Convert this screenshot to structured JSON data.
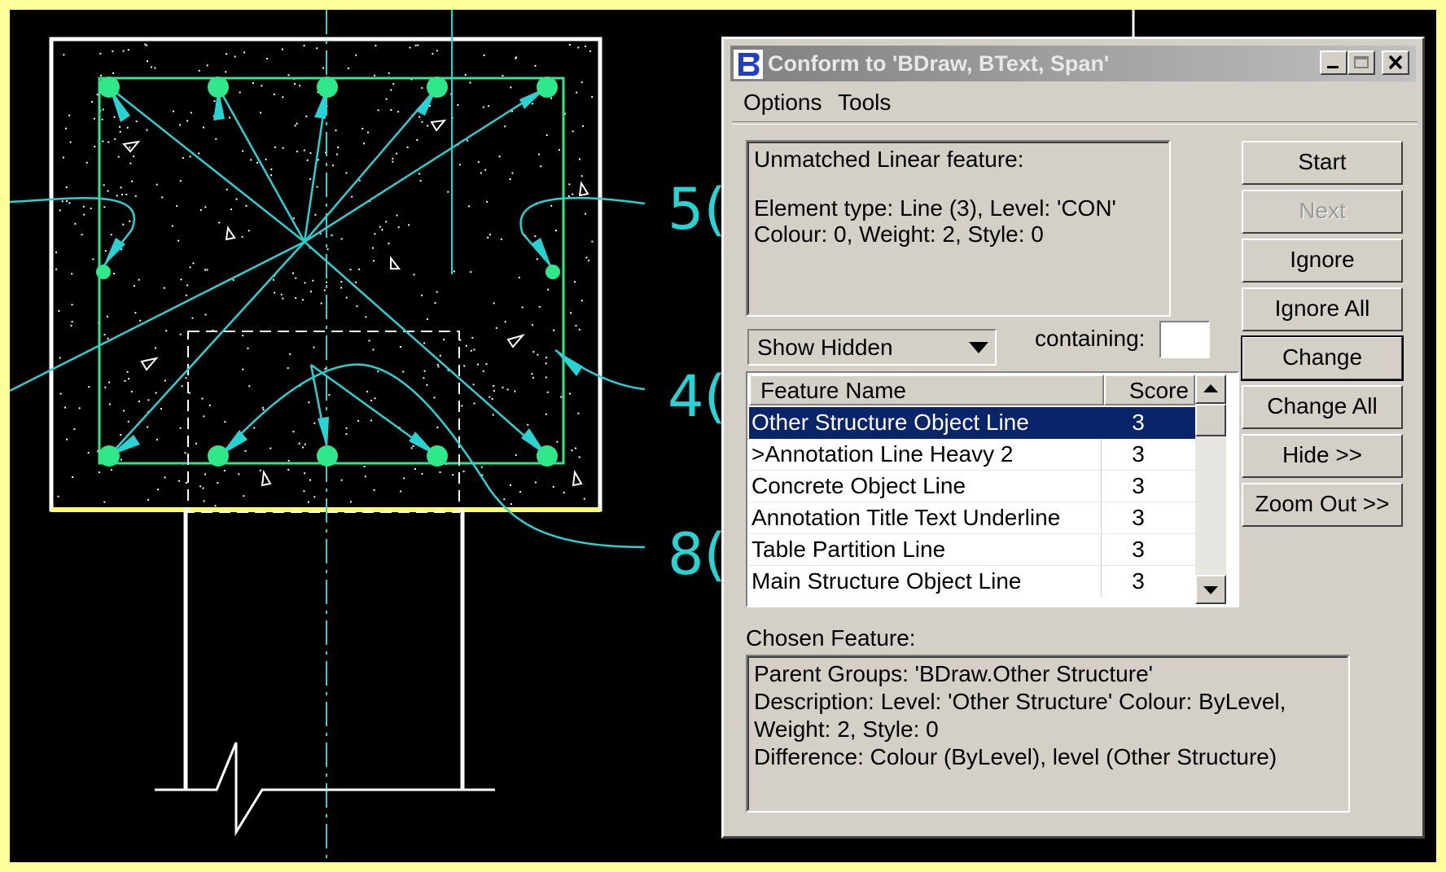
{
  "cad": {
    "dim_labels": [
      "5(",
      "4(",
      "8("
    ],
    "colors": {
      "background": "#000000",
      "cyan": "#27d3d3",
      "green": "#2ee88a",
      "white": "#ffffff",
      "yellow": "#ffff66"
    }
  },
  "dialog": {
    "title": "Conform to 'BDraw, BText, Span'",
    "menu": {
      "options": "Options",
      "tools": "Tools"
    },
    "info": {
      "line1": "Unmatched Linear feature:",
      "line2": "Element type: Line (3), Level: 'CON'",
      "line3": "Colour: 0, Weight: 2, Style: 0"
    },
    "buttons": {
      "start": "Start",
      "next": "Next",
      "ignore": "Ignore",
      "ignore_all": "Ignore All",
      "change": "Change",
      "change_all": "Change All",
      "hide": "Hide >>",
      "zoom_out": "Zoom Out >>"
    },
    "filter": {
      "selected": "Show Hidden",
      "containing_label": "containing:",
      "containing_value": ""
    },
    "list": {
      "headers": {
        "name": "Feature Name",
        "score": "Score"
      },
      "rows": [
        {
          "name": "Other Structure Object Line",
          "score": "3"
        },
        {
          "name": ">Annotation Line Heavy 2",
          "score": "3"
        },
        {
          "name": "Concrete Object Line",
          "score": "3"
        },
        {
          "name": "Annotation Title Text Underline",
          "score": "3"
        },
        {
          "name": "Table Partition Line",
          "score": "3"
        },
        {
          "name": "Main Structure Object Line",
          "score": "3"
        }
      ]
    },
    "chosen": {
      "label": "Chosen Feature:",
      "line1": "Parent Groups: 'BDraw.Other Structure'",
      "line2": "Description:     Level: 'Other Structure' Colour: ByLevel,",
      "line3": "Weight: 2, Style: 0",
      "line4": "Difference:       Colour (ByLevel), level (Other Structure)"
    }
  }
}
